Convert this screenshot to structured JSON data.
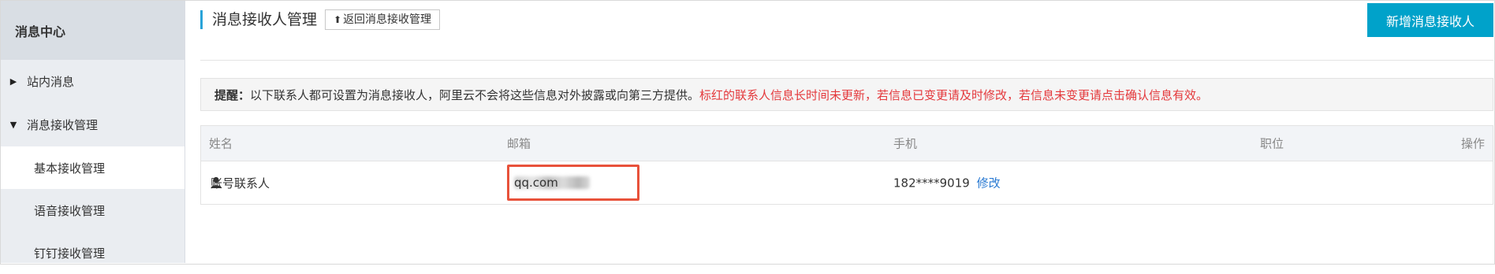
{
  "sidebar": {
    "title": "消息中心",
    "groups": [
      {
        "label": "站内消息",
        "expanded": false,
        "arrow": "▶"
      },
      {
        "label": "消息接收管理",
        "expanded": true,
        "arrow": "▼"
      }
    ],
    "sub_items": [
      {
        "label": "基本接收管理",
        "active": true
      },
      {
        "label": "语音接收管理",
        "active": false
      },
      {
        "label": "钉钉接收管理",
        "active": false
      }
    ]
  },
  "header": {
    "title": "消息接收人管理",
    "back_label": "返回消息接收管理",
    "back_icon": "⬆",
    "new_label": "新增消息接收人"
  },
  "notice": {
    "label": "提醒：",
    "text": "以下联系人都可设置为消息接收人，阿里云不会将这些信息对外披露或向第三方提供。",
    "warning": "标红的联系人信息长时间未更新，若信息已变更请及时修改，若信息未变更请点击确认信息有效。"
  },
  "table": {
    "columns": {
      "name": "姓名",
      "email": "邮箱",
      "phone": "手机",
      "position": "职位",
      "action": "操作"
    },
    "rows": [
      {
        "name": "账号联系人",
        "email_domain": "qq.com",
        "phone": "182****9019",
        "edit": "修改",
        "position": ""
      }
    ]
  },
  "colors": {
    "accent": "#00a2ca",
    "warning": "#e4393c",
    "highlight_box": "#e8523b",
    "link": "#2a7ad2"
  }
}
